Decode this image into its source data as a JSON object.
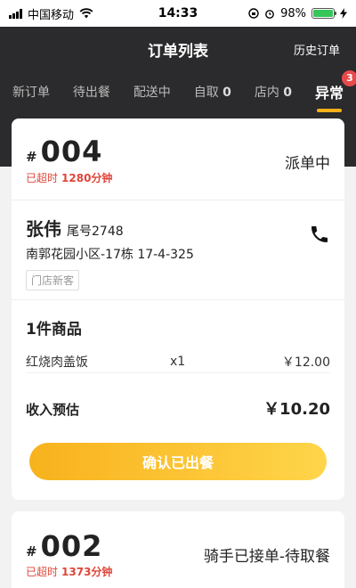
{
  "status_bar": {
    "carrier": "中国移动",
    "time": "14:33",
    "battery": "98%",
    "battery_level": 0.98,
    "icons": [
      "signal-icon",
      "wifi-icon",
      "lock-rotation-icon",
      "alarm-icon",
      "battery-icon",
      "charging-icon"
    ]
  },
  "header": {
    "title": "订单列表",
    "history_label": "历史订单",
    "tabs": [
      {
        "label": "新订单",
        "count": ""
      },
      {
        "label": "待出餐",
        "count": ""
      },
      {
        "label": "配送中",
        "count": ""
      },
      {
        "label": "自取",
        "count": "0"
      },
      {
        "label": "店内",
        "count": "0"
      },
      {
        "label": "异常",
        "count": "",
        "badge": "3",
        "active": true
      }
    ]
  },
  "orders": [
    {
      "hash": "#",
      "number": "004",
      "status": "派单中",
      "overdue_label": "已超时",
      "overdue_value": "1280分钟",
      "customer_name": "张伟",
      "tail_number": "尾号2748",
      "address": "南郭花园小区-17栋 17-4-325",
      "customer_tag": "门店新客",
      "goods_title": "1件商品",
      "items": [
        {
          "name": "红烧肉盖饭",
          "qty": "x1",
          "price": "￥12.00"
        }
      ],
      "income_label": "收入预估",
      "income_value": "￥10.20",
      "confirm_label": "确认已出餐"
    },
    {
      "hash": "#",
      "number": "002",
      "status": "骑手已接单-待取餐",
      "overdue_label": "已超时",
      "overdue_value": "1373分钟"
    }
  ],
  "colors": {
    "header_bg": "#2b2b2d",
    "accent": "#f5b01a",
    "overdue": "#e0453a",
    "badge": "#e84a4a"
  }
}
